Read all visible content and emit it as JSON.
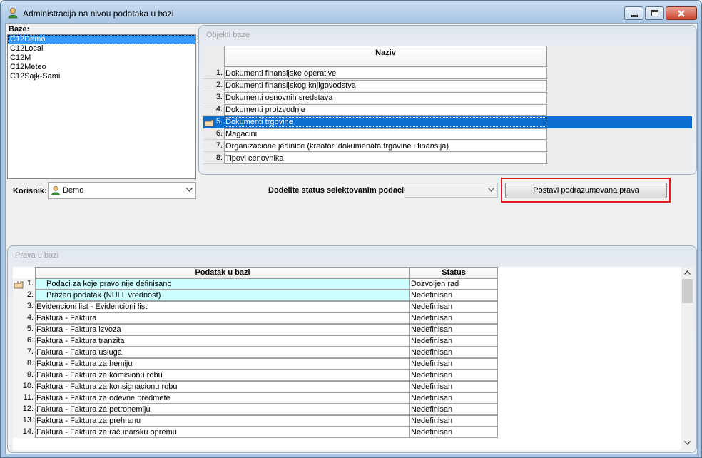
{
  "window": {
    "title": "Administracija na nivou podataka u bazi"
  },
  "baze": {
    "label": "Baze:",
    "items": [
      "C12Demo",
      "C12Local",
      "C12M",
      "C12Meteo",
      "C12Sajk-Sami"
    ],
    "selected_index": 0
  },
  "objekti": {
    "panel_title": "Objekti baze",
    "header": "Naziv",
    "rows": [
      {
        "num": "1.",
        "naziv": "Dokumenti finansijske operative"
      },
      {
        "num": "2.",
        "naziv": "Dokumenti finansijskog knjigovodstva"
      },
      {
        "num": "3.",
        "naziv": "Dokumenti osnovnih sredstava"
      },
      {
        "num": "4.",
        "naziv": "Dokumenti proizvodnje"
      },
      {
        "num": "5.",
        "naziv": "Dokumenti trgovine"
      },
      {
        "num": "6.",
        "naziv": "Magacini"
      },
      {
        "num": "7.",
        "naziv": "Organizacione jedinice (kreatori dokumenata trgovine i finansija)"
      },
      {
        "num": "8.",
        "naziv": "Tipovi cenovnika"
      }
    ],
    "selected_index": 4
  },
  "korisnik": {
    "label": "Korisnik:",
    "value": "Demo",
    "icon": "user-icon"
  },
  "status_assign": {
    "label": "Dodelite status selektovanim podacima:",
    "value": ""
  },
  "postavi_button": {
    "label": "Postavi podrazumevana prava"
  },
  "prava": {
    "panel_title": "Prava u bazi",
    "headers": [
      "Podatak u bazi",
      "Status"
    ],
    "rows": [
      {
        "num": "1.",
        "podatak": "Podaci za koje pravo nije definisano",
        "status": "Dozvoljen rad",
        "special": true
      },
      {
        "num": "2.",
        "podatak": "Prazan podatak (NULL vrednost)",
        "status": "Nedefinisan",
        "special": true
      },
      {
        "num": "3.",
        "podatak": "Evidencioni list - Evidencioni list",
        "status": "Nedefinisan",
        "special": false
      },
      {
        "num": "4.",
        "podatak": "Faktura - Faktura",
        "status": "Nedefinisan",
        "special": false
      },
      {
        "num": "5.",
        "podatak": "Faktura - Faktura izvoza",
        "status": "Nedefinisan",
        "special": false
      },
      {
        "num": "6.",
        "podatak": "Faktura - Faktura tranzita",
        "status": "Nedefinisan",
        "special": false
      },
      {
        "num": "7.",
        "podatak": "Faktura - Faktura usluga",
        "status": "Nedefinisan",
        "special": false
      },
      {
        "num": "8.",
        "podatak": "Faktura - Faktura za hemiju",
        "status": "Nedefinisan",
        "special": false
      },
      {
        "num": "9.",
        "podatak": "Faktura - Faktura za komisionu robu",
        "status": "Nedefinisan",
        "special": false
      },
      {
        "num": "10.",
        "podatak": "Faktura - Faktura za konsignacionu robu",
        "status": "Nedefinisan",
        "special": false
      },
      {
        "num": "11.",
        "podatak": "Faktura - Faktura za odevne predmete",
        "status": "Nedefinisan",
        "special": false
      },
      {
        "num": "12.",
        "podatak": "Faktura - Faktura za petrohemiju",
        "status": "Nedefinisan",
        "special": false
      },
      {
        "num": "13.",
        "podatak": "Faktura - Faktura za prehranu",
        "status": "Nedefinisan",
        "special": false
      },
      {
        "num": "14.",
        "podatak": "Faktura - Faktura za računarsku opremu",
        "status": "Nedefinisan",
        "special": false
      }
    ],
    "current_index": 0
  },
  "colors": {
    "selection": "#0b6fd1",
    "list_selection": "#3399ff",
    "special_row": "#ccffff",
    "highlight_box": "#e01e1e"
  }
}
